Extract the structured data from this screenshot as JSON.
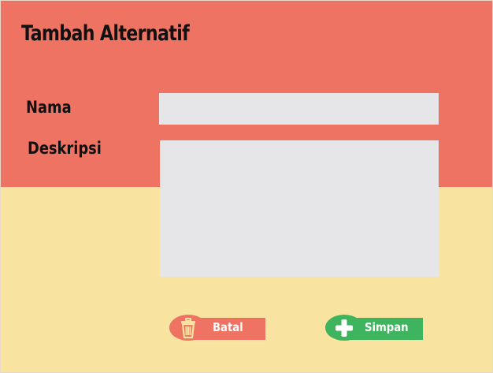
{
  "form": {
    "title": "Tambah Alternatif",
    "fields": {
      "nama": {
        "label": "Nama",
        "value": ""
      },
      "deskripsi": {
        "label": "Deskripsi",
        "value": ""
      }
    }
  },
  "actions": {
    "cancel": {
      "label": "Batal",
      "icon": "trash-icon",
      "color": "#ef7362"
    },
    "save": {
      "label": "Simpan",
      "icon": "plus-icon",
      "color": "#3fb45f"
    }
  },
  "theme": {
    "header_color": "#ef7362",
    "body_color": "#f8e4a0",
    "input_color": "#e6e6e8"
  }
}
